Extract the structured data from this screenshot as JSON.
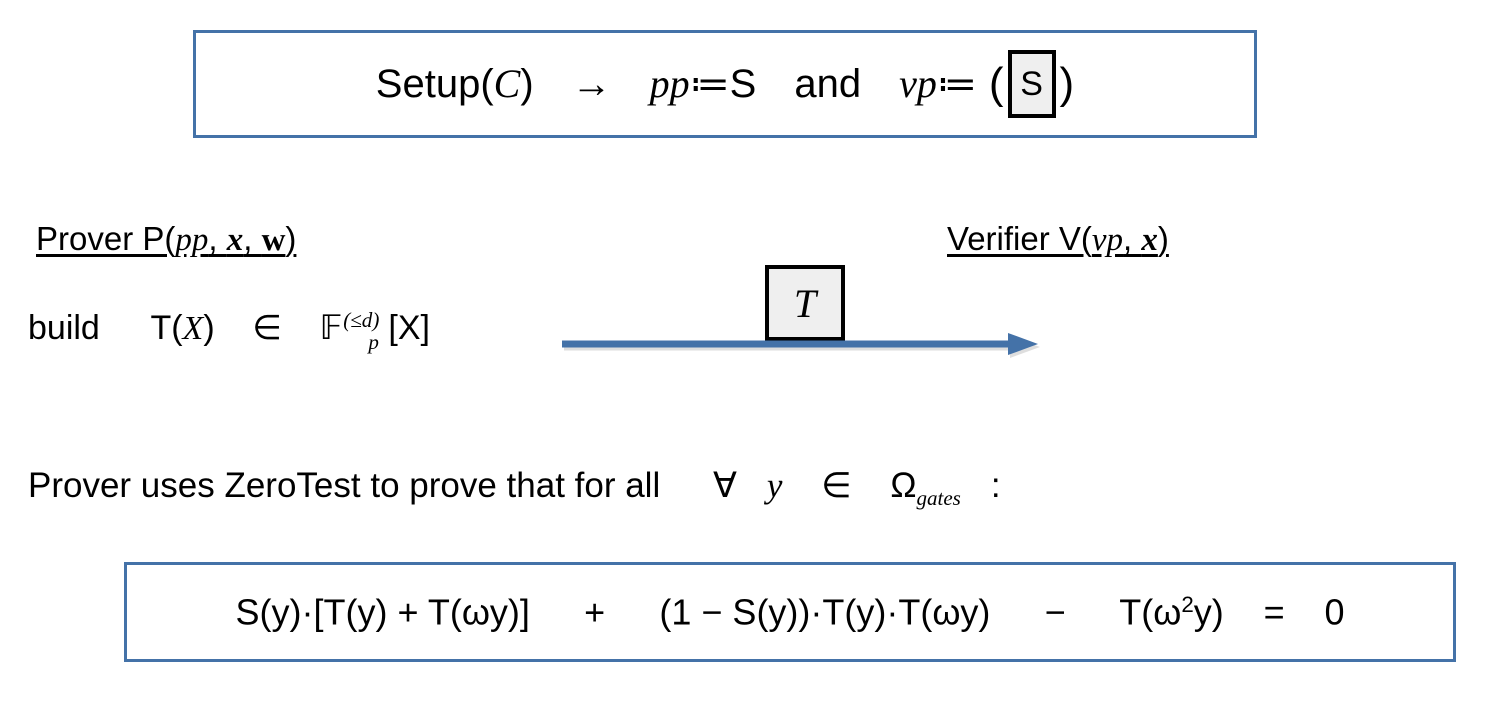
{
  "slide": {
    "title": "PLONK-style polynomial IOP: setup, prover message and ZeroTest identity",
    "accent_blue": "#4472A8",
    "commit_box_fill": "#efefef",
    "background": "#ffffff"
  },
  "setup_box": {
    "name": "Setup",
    "function_arg": "C",
    "arrow": "→",
    "pp_symbol": "pp",
    "assign": "≔",
    "pp_value": "S",
    "conjunction": "and",
    "vp_symbol": "vp",
    "vp_open_paren": "(",
    "vp_commitment": "S",
    "vp_close_paren": ")"
  },
  "prover": {
    "label_prefix": "Prover P(",
    "arg_pp": "pp",
    "arg_x": "x",
    "arg_w": "w",
    "label_suffix": ")",
    "comma": ", "
  },
  "verifier": {
    "label_prefix": "Verifier V(",
    "arg_vp": "vp",
    "arg_x": "x",
    "label_suffix": ")",
    "comma": ", "
  },
  "build_line": {
    "verb": "build",
    "poly_name": "T",
    "poly_open": "(",
    "poly_var": "X",
    "poly_close": ")",
    "member_of": "∈",
    "field": "𝔽",
    "field_subscript": "p",
    "field_superscript": "(≤d)",
    "ring_var": "[X]"
  },
  "message": {
    "commitment_label": "T",
    "direction": "prover-to-verifier",
    "arrow_color": "#4472A8"
  },
  "zerotest_line": {
    "text_before": "Prover uses ZeroTest to prove that for all",
    "forall": "∀",
    "variable": "y",
    "member_of": "∈",
    "domain": "Ω",
    "domain_subscript": "gates",
    "colon": ":"
  },
  "equation": {
    "full_text": "S(y)·[T(y) + T(ωy)]  +  (1 − S(y))·T(y)·T(ωy)  −  T(ω²y)  =  0",
    "tokens": [
      "S(y)·[T(y) + T(ωy)]",
      "+",
      "(1 − S(y))·T(y)·T(ωy)",
      "−",
      "T(ω",
      "2",
      "y)",
      "=",
      "0"
    ]
  }
}
